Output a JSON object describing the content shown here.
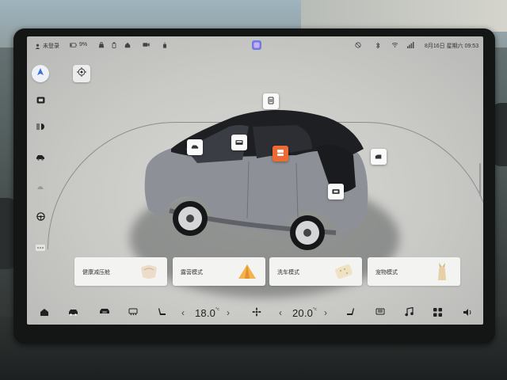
{
  "status_bar": {
    "login_status": "未登录",
    "battery_percent": "9%",
    "date_time": "8月16日 星期六 09:53"
  },
  "temperatures": {
    "driver": "18.0",
    "passenger": "20.0",
    "unit": "°c"
  },
  "modes": [
    {
      "label": "健康减压舱"
    },
    {
      "label": "露营模式"
    },
    {
      "label": "洗车模式"
    },
    {
      "label": "宠物模式"
    }
  ],
  "colors": {
    "accent": "#ef6a33",
    "screen_bg": "#cfcfcc",
    "car_body": "#8e9097",
    "car_roof": "#1e1f22"
  },
  "icons": {
    "status_bar": [
      "user-icon",
      "battery-icon",
      "bag-icon",
      "phone-upload-icon",
      "cabin-icon",
      "camera-icon",
      "sanitize-icon",
      "app-store-icon",
      "no-signal-icon",
      "bluetooth-icon",
      "wifi-icon",
      "cellular-icon"
    ],
    "left_rail": [
      "navigation-arrow-icon",
      "seat-icon",
      "headlight-icon",
      "car-side-icon",
      "wiper-icon",
      "steering-wheel-icon",
      "more-icon"
    ],
    "dock": [
      "home-icon",
      "car-icon",
      "camera-360-icon",
      "rear-defrost-icon",
      "driver-seat-icon",
      "fan-icon",
      "passenger-seat-icon",
      "front-defrost-icon",
      "music-icon",
      "apps-grid-icon",
      "volume-icon"
    ]
  }
}
